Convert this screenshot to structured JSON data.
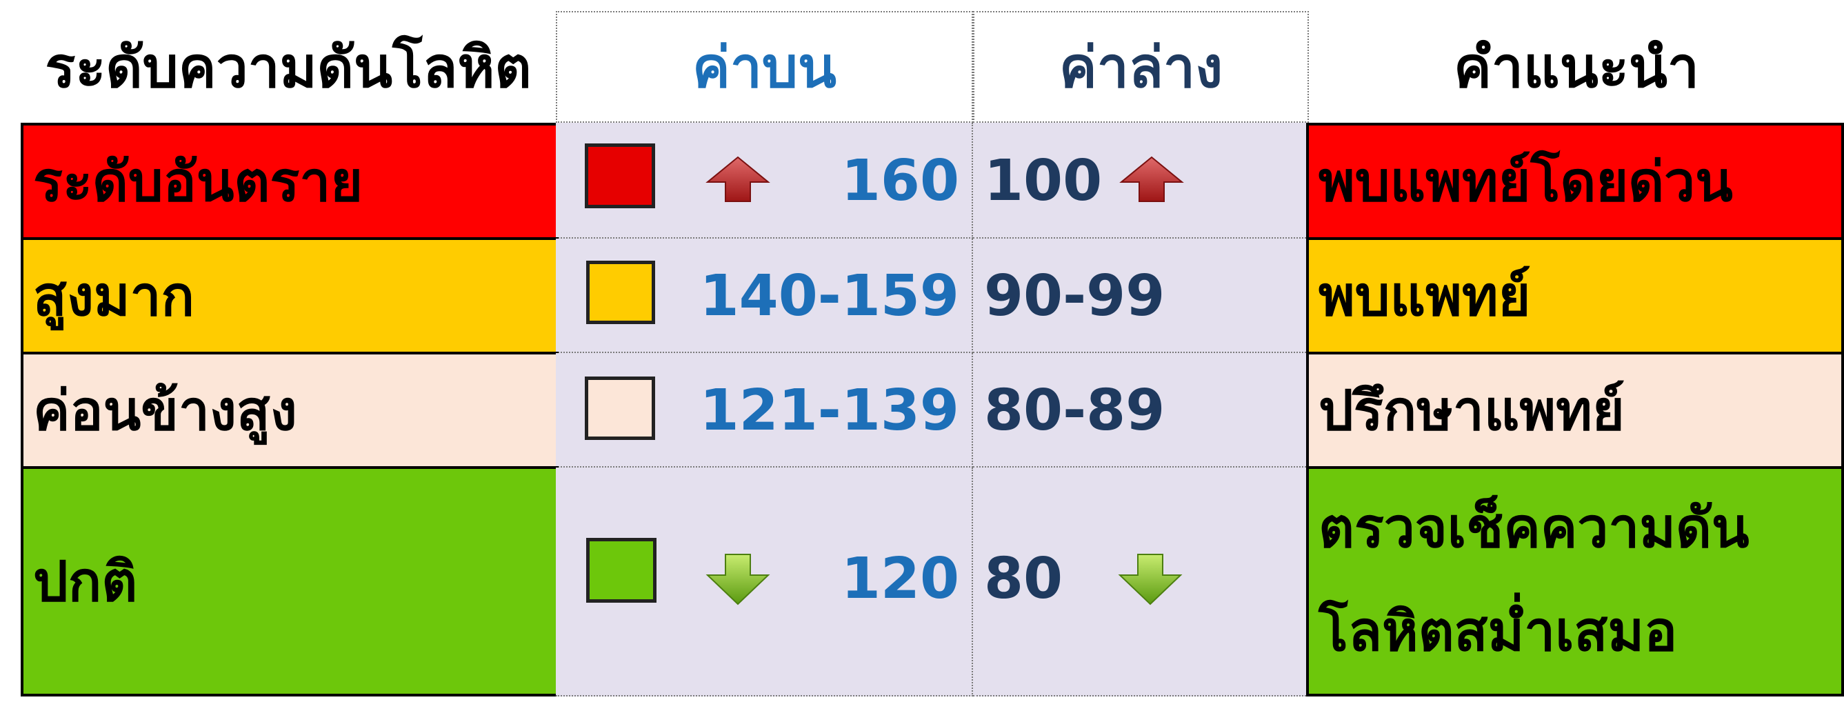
{
  "header": {
    "level": "ระดับความดันโลหิต",
    "upper": "ค่าบน",
    "lower": "ค่าล่าง",
    "advice": "คำแนะนำ"
  },
  "colors": {
    "danger": "#ff0000",
    "very_high": "#ffcc00",
    "fairly_high": "#fce6d8",
    "normal": "#6dc70b",
    "value_bg": "#e4e0ee",
    "upper_text": "#1d6fb8",
    "lower_text": "#1f3a5f"
  },
  "rows": [
    {
      "level": "ระดับอันตราย",
      "upper": "160",
      "lower": "100",
      "advice": "พบแพทย์โดยด่วน",
      "swatch_color": "#e60000",
      "arrow": "up-arrow-icon"
    },
    {
      "level": "สูงมาก",
      "upper": "140-159",
      "lower": "90-99",
      "advice": "พบแพทย์",
      "swatch_color": "#ffcc00",
      "arrow": ""
    },
    {
      "level": "ค่อนข้างสูง",
      "upper": "121-139",
      "lower": "80-89",
      "advice": "ปรึกษาแพทย์",
      "swatch_color": "#fce6d8",
      "arrow": ""
    },
    {
      "level": "ปกติ",
      "upper": "120",
      "lower": "80",
      "advice_line1": "ตรวจเช็คความดัน",
      "advice_line2": "โลหิตสม่ำเสมอ",
      "swatch_color": "#6dc70b",
      "arrow": "down-arrow-icon"
    }
  ]
}
